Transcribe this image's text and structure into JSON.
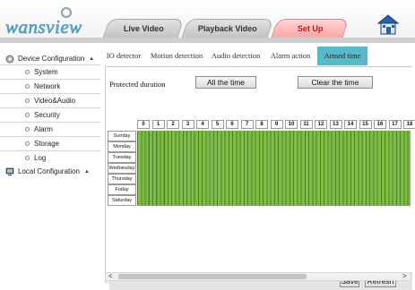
{
  "brand": {
    "logo_text": "wansview"
  },
  "nav": {
    "tabs": [
      {
        "label": "Live Video",
        "active": false
      },
      {
        "label": "Playback Video",
        "active": false
      },
      {
        "label": "Set Up",
        "active": true
      }
    ],
    "home_icon": "home-icon"
  },
  "sidebar": {
    "device_group": {
      "label": "Device Configuration",
      "icon": "gear-icon"
    },
    "items": [
      {
        "label": "System"
      },
      {
        "label": "Network"
      },
      {
        "label": "Video&Audio"
      },
      {
        "label": "Security"
      },
      {
        "label": "Alarm"
      },
      {
        "label": "Storage"
      },
      {
        "label": "Log"
      }
    ],
    "local_group": {
      "label": "Local Configuration",
      "icon": "monitor-icon"
    }
  },
  "subtabs": [
    {
      "label": "IO detector",
      "active": false
    },
    {
      "label": "Motion detection",
      "active": false
    },
    {
      "label": "Audio detection",
      "active": false
    },
    {
      "label": "Alarm action",
      "active": false
    },
    {
      "label": "Armed time",
      "active": true
    }
  ],
  "armed_time": {
    "title": "Protected duration",
    "all_time_button": "All the time",
    "clear_time_button": "Clear the time",
    "hours": [
      "0",
      "1",
      "2",
      "3",
      "4",
      "5",
      "6",
      "7",
      "8",
      "9",
      "10",
      "11",
      "12",
      "13",
      "14",
      "15",
      "16",
      "17",
      "18"
    ],
    "days": [
      "Sunday",
      "Monday",
      "Tuesday",
      "Wednesday",
      "Thursday",
      "Friday",
      "Saturday"
    ],
    "armed_all_cells": true,
    "armed_color": "#7ebc45",
    "save_button": "Save",
    "refresh_button": "Refresh"
  },
  "colors": {
    "active_tab": "#ffa6a6",
    "active_subtab": "#5ab8c8"
  }
}
